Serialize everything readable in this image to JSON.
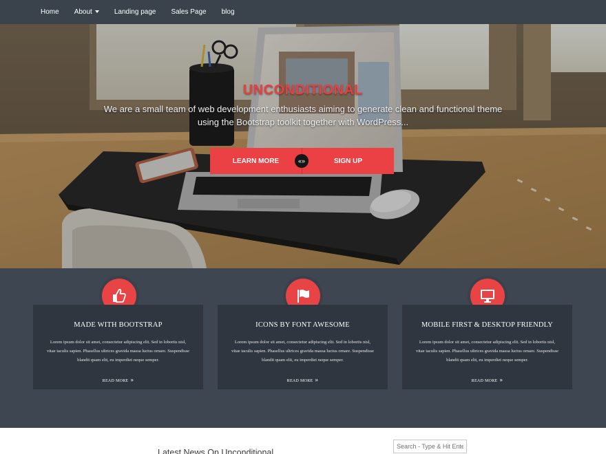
{
  "nav": {
    "items": [
      {
        "label": "Home"
      },
      {
        "label": "About"
      },
      {
        "label": "Landing page"
      },
      {
        "label": "Sales Page"
      },
      {
        "label": "blog"
      }
    ]
  },
  "hero": {
    "title": "UNCONDITIONAL",
    "subtitle_line1": "We are a small team of web development enthusiasts aiming to generate clean and functional theme",
    "subtitle_line2": "using the Bootstrap toolkit together with WordPress...",
    "learn_more_label": "LEARN MORE",
    "or_glyph": "«»",
    "sign_up_label": "SIGN UP"
  },
  "features": [
    {
      "icon": "thumbs-up-icon",
      "title": "MADE WITH BOOTSTRAP",
      "text": "Lorem ipsum dolor sit amet, consectetur adipiscing elit. Sed in lobortis nisl, vitae iaculis sapien. Phasellus ultrices gravida massa luctus ornare. Suspendisse blandit quam elit, eu imperdiet neque semper.",
      "link": "READ MORE"
    },
    {
      "icon": "flag-icon",
      "title": "ICONS BY FONT AWESOME",
      "text": "Lorem ipsum dolor sit amet, consectetur adipiscing elit. Sed in lobortis nisl, vitae iaculis sapien. Phasellus ultrices gravida massa luctus ornare. Suspendisse blandit quam elit, eu imperdiet neque semper.",
      "link": "READ MORE"
    },
    {
      "icon": "desktop-icon",
      "title": "MOBILE FIRST & DESKTOP FRIENDLY",
      "text": "Lorem ipsum dolor sit amet, consectetur adipiscing elit. Sed in lobortis nisl, vitae iaculis sapien. Phasellus ultrices gravida massa luctus ornare. Suspendisse blandit quam elit, eu imperdiet neque semper.",
      "link": "READ MORE"
    }
  ],
  "read_more_arrow": "»",
  "news": {
    "title": "Latest News On Unconditional"
  },
  "search": {
    "placeholder": "Search - Type & Hit Enter"
  },
  "colors": {
    "accent": "#e84446",
    "nav_bg": "#3a424c",
    "features_bg": "#3d4651",
    "card_bg": "#2f363f"
  }
}
